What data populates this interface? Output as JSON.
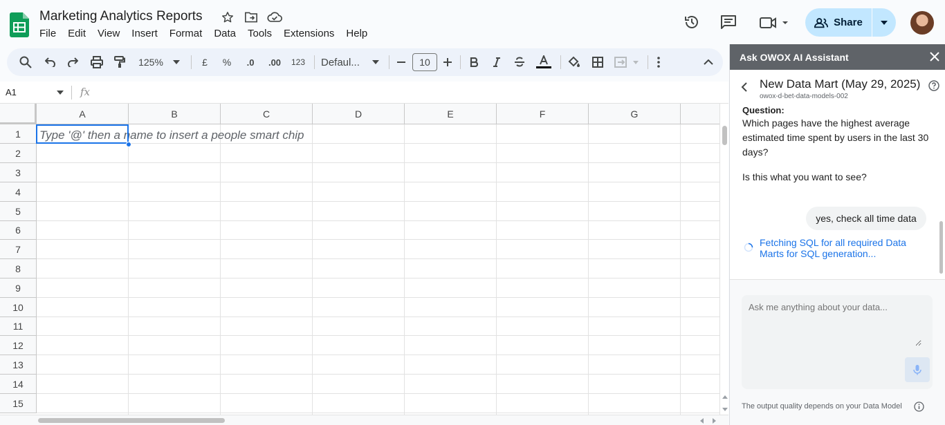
{
  "doc": {
    "title": "Marketing Analytics Reports",
    "menu": [
      "File",
      "Edit",
      "View",
      "Insert",
      "Format",
      "Data",
      "Tools",
      "Extensions",
      "Help"
    ]
  },
  "header": {
    "share_label": "Share"
  },
  "toolbar": {
    "zoom": "125%",
    "currency": "£",
    "percent": "%",
    "dec_decrease": ".0",
    "dec_increase": ".00",
    "number_format": "123",
    "font": "Defaul...",
    "font_size": "10"
  },
  "formula_bar": {
    "cell_ref": "A1",
    "fx": "fx"
  },
  "grid": {
    "columns": [
      "A",
      "B",
      "C",
      "D",
      "E",
      "F",
      "G"
    ],
    "rows": [
      "1",
      "2",
      "3",
      "4",
      "5",
      "6",
      "7",
      "8",
      "9",
      "10",
      "11",
      "12",
      "13",
      "14",
      "15"
    ],
    "cell_hint": "Type '@' then a name to insert a people smart chip"
  },
  "panel": {
    "header_title": "Ask OWOX AI Assistant",
    "data_mart_title": "New Data Mart (May 29, 2025)",
    "data_mart_subtitle": "owox-d-bet-data-models-002",
    "question_label": "Question:",
    "question_text": "Which pages have the highest average estimated time spent by users in the last 30 days?",
    "confirm_text": "Is this what you want to see?",
    "user_message": "yes, check all time data",
    "status_message": "Fetching SQL for all required Data Marts for SQL generation...",
    "input_placeholder": "Ask me anything about your data...",
    "disclaimer": "The output quality depends on your Data Model"
  },
  "colors": {
    "accent": "#1a73e8",
    "share_bg": "#c2e7ff",
    "panel_header": "#5f6368",
    "sheets_green": "#0f9d58"
  }
}
